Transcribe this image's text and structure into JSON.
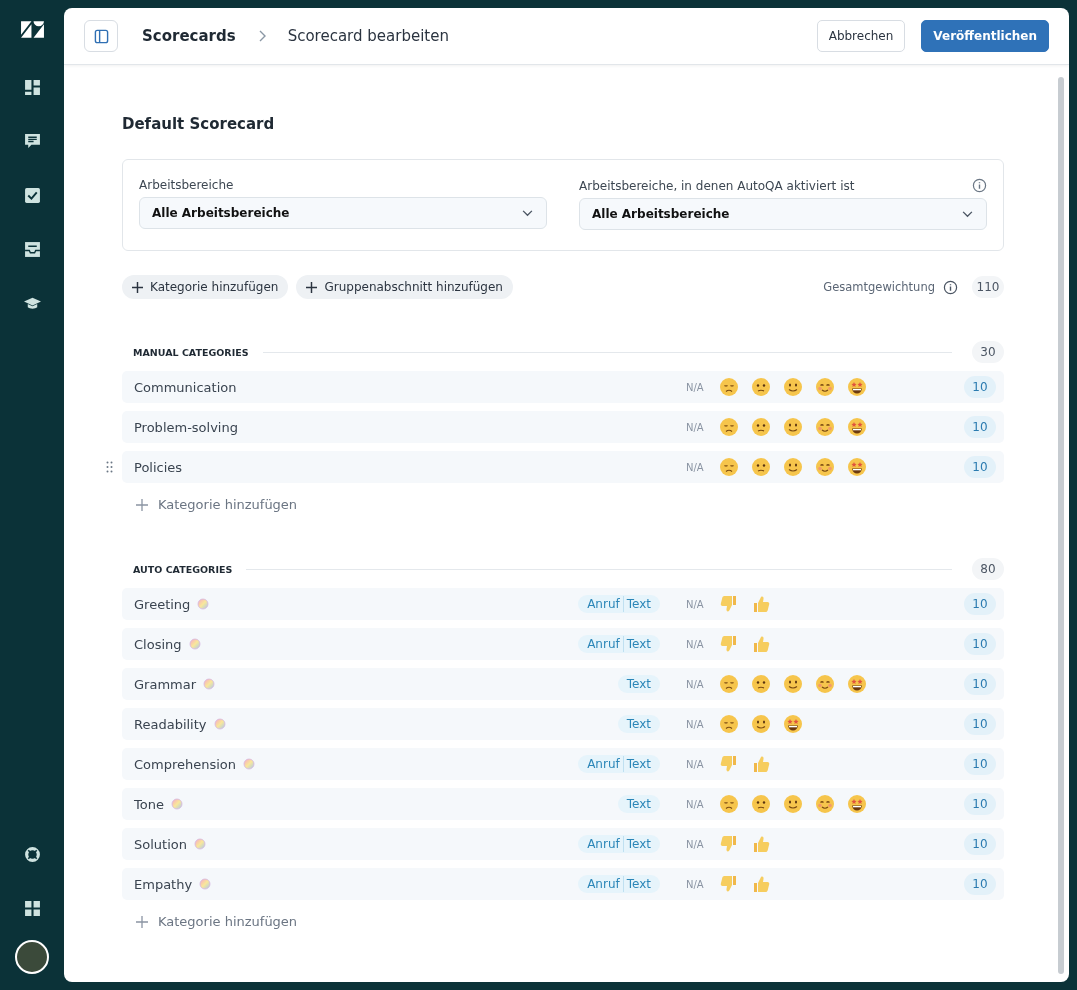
{
  "header": {
    "breadcrumb": [
      "Scorecards",
      "Scorecard bearbeiten"
    ],
    "cancel": "Abbrechen",
    "publish": "Veröffentlichen"
  },
  "title": "Default Scorecard",
  "filter_panel": {
    "info": true,
    "filters": [
      {
        "label": "Arbeitsbereiche",
        "value": "Alle Arbeitsbereiche"
      },
      {
        "label": "Arbeitsbereiche, in denen AutoQA aktiviert ist",
        "value": "Alle Arbeitsbereiche"
      }
    ]
  },
  "actions": [
    "Kategorie hinzufügen",
    "Gruppenabschnitt hinzufügen"
  ],
  "total": {
    "label": "Gesamtgewichtung",
    "value": "110"
  },
  "sections": [
    {
      "title": "MANUAL CATEGORIES",
      "weight": "30",
      "add": "Kategorie hinzufügen",
      "rows": [
        {
          "name": "Communication",
          "auto": false,
          "hovered": false,
          "channels": [],
          "na": "N/A",
          "kind": "five",
          "weight": "10"
        },
        {
          "name": "Problem-solving",
          "auto": false,
          "hovered": false,
          "channels": [],
          "na": "N/A",
          "kind": "five",
          "weight": "10"
        },
        {
          "name": "Policies",
          "auto": false,
          "hovered": true,
          "channels": [],
          "na": "N/A",
          "kind": "five",
          "weight": "10"
        }
      ]
    },
    {
      "title": "AUTO CATEGORIES",
      "weight": "80",
      "add": "Kategorie hinzufügen",
      "rows": [
        {
          "name": "Greeting",
          "auto": true,
          "hovered": false,
          "channels": [
            "Anruf",
            "Text"
          ],
          "na": "N/A",
          "kind": "thumbs",
          "weight": "10"
        },
        {
          "name": "Closing",
          "auto": true,
          "hovered": false,
          "channels": [
            "Anruf",
            "Text"
          ],
          "na": "N/A",
          "kind": "thumbs",
          "weight": "10"
        },
        {
          "name": "Grammar",
          "auto": true,
          "hovered": false,
          "channels": [
            "Text"
          ],
          "na": "N/A",
          "kind": "five",
          "weight": "10"
        },
        {
          "name": "Readability",
          "auto": true,
          "hovered": false,
          "channels": [
            "Text"
          ],
          "na": "N/A",
          "kind": "three",
          "weight": "10"
        },
        {
          "name": "Comprehension",
          "auto": true,
          "hovered": false,
          "channels": [
            "Anruf",
            "Text"
          ],
          "na": "N/A",
          "kind": "thumbs",
          "weight": "10"
        },
        {
          "name": "Tone",
          "auto": true,
          "hovered": false,
          "channels": [
            "Text"
          ],
          "na": "N/A",
          "kind": "five",
          "weight": "10"
        },
        {
          "name": "Solution",
          "auto": true,
          "hovered": false,
          "channels": [
            "Anruf",
            "Text"
          ],
          "na": "N/A",
          "kind": "thumbs",
          "weight": "10"
        },
        {
          "name": "Empathy",
          "auto": true,
          "hovered": false,
          "channels": [
            "Anruf",
            "Text"
          ],
          "na": "N/A",
          "kind": "thumbs",
          "weight": "10"
        }
      ]
    }
  ]
}
